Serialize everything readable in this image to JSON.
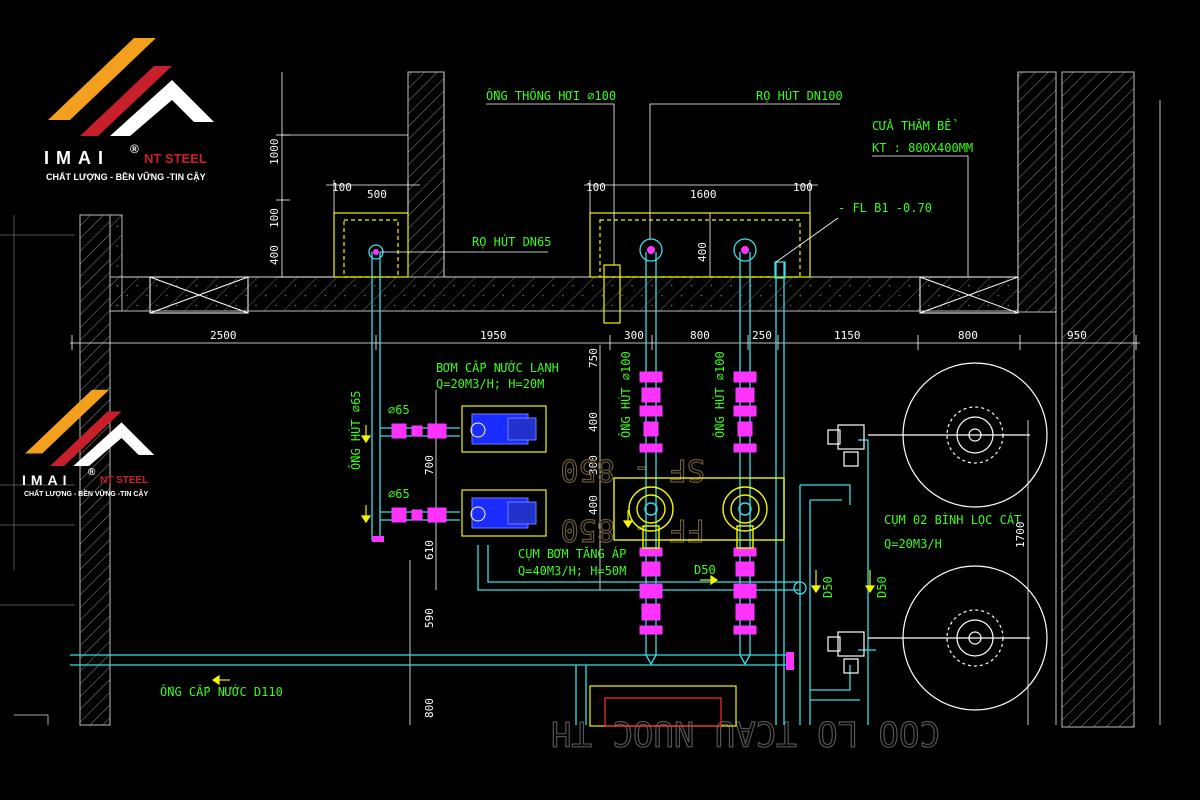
{
  "colors": {
    "background": "#000000",
    "dimension": "#ffffff",
    "label": "#39ff14",
    "pipe": "#36e0e8",
    "valve": "#ff33ff",
    "pump_yellow": "#f5f500",
    "wall_hatch": "#9a9a9a",
    "logo_orange": "#f2a01e",
    "logo_red": "#c8202b"
  },
  "logo": {
    "name": "IMAI",
    "registered": "®",
    "suffix": "NT STEEL",
    "tagline": "CHẤT LƯỢNG - BỀN VỮNG -TIN CẬY"
  },
  "labels": {
    "vent_pipe": "ỐNG THÔNG HƠI ∅100",
    "suction_dn100": "RỌ HÚT DN100",
    "tank_door": "CỬA THĂM BỂ",
    "tank_door_size": "KT : 800X400MM",
    "floor_level": "- FL B1 -0.70",
    "suction_dn65": "RỌ HÚT DN65",
    "cold_pump": "BƠM CẤP NƯỚC LẠNH",
    "cold_pump_spec": "Q=20M3/H; H=20M",
    "suction_pipe_65": "ỐNG HÚT ∅65",
    "phi65_top": "∅65",
    "phi65_bottom": "∅65",
    "suction_pipe_100_a": "ỐNG HÚT ∅100",
    "suction_pipe_100_b": "ỐNG HÚT ∅100",
    "booster_pump": "CỤM BƠM TĂNG ÁP",
    "booster_spec": "Q=40M3/H; H=50M",
    "d50_horizontal": "D50",
    "d50_vertical_a": "D50",
    "d50_vertical_b": "D50",
    "sand_filter": "CỤM 02 BÌNH LỌC CÁT",
    "sand_filter_spec": "Q=20M3/H",
    "supply_pipe": "ỐNG CẤP NƯỚC D110"
  },
  "dims": {
    "top_100a": "100",
    "top_500": "500",
    "top_100b": "100",
    "top_1600": "1600",
    "top_100c": "100",
    "left_1000": "1000",
    "left_100": "100",
    "left_400a": "400",
    "mid_400": "400",
    "row_2500": "2500",
    "row_1950": "1950",
    "row_300": "300",
    "row_800a": "800",
    "row_250": "250",
    "row_1150": "1150",
    "row_800b": "800",
    "row_950": "950",
    "v_750": "750",
    "v_400a": "400",
    "v_300": "300",
    "v_400b": "400",
    "v_700": "700",
    "v_610": "610",
    "v_590": "590",
    "v_800": "800",
    "v_1700": "1700"
  },
  "faded_text": {
    "a": "SF - 850",
    "b": "FF - 850",
    "bottom": "COO LO TCAU NUOC TH"
  }
}
